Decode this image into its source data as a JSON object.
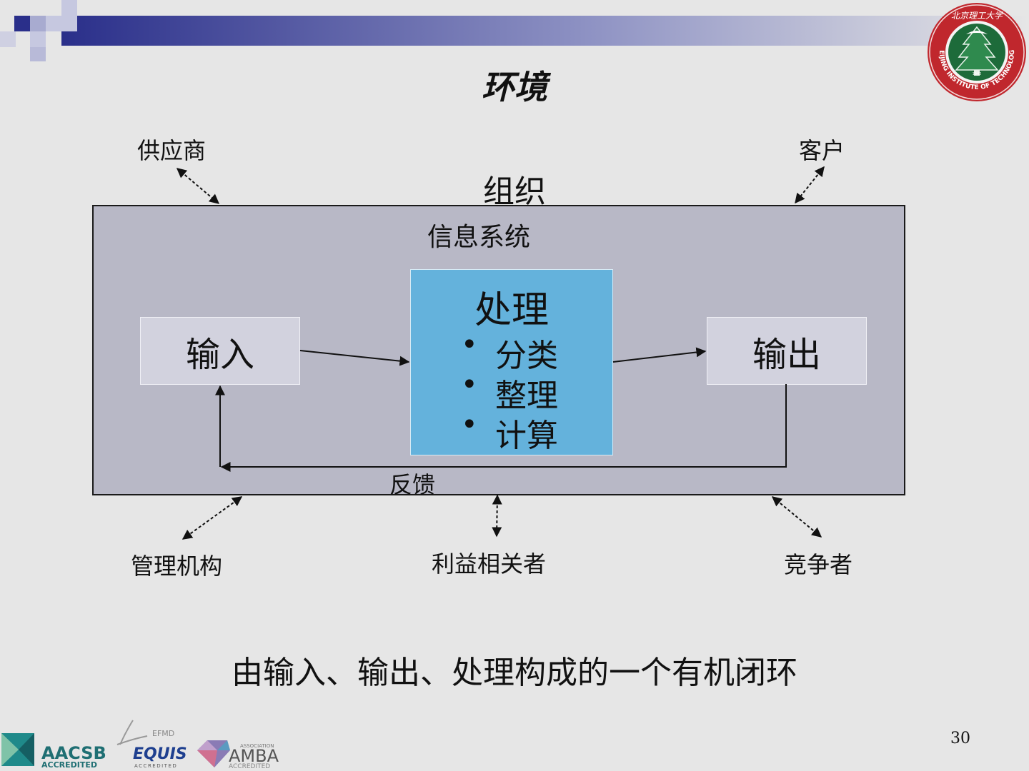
{
  "slide": {
    "title": "环境",
    "page_number": "30",
    "caption": "由输入、输出、处理构成的一个有机闭环"
  },
  "diagram": {
    "organization": "组织",
    "information_system": "信息系统",
    "input": "输入",
    "output": "输出",
    "process": {
      "title": "处理",
      "items": [
        "分类",
        "整理",
        "计算"
      ],
      "bullet": "•"
    },
    "feedback": "反馈",
    "external": {
      "supplier": "供应商",
      "customer": "客户",
      "regulator": "管理机构",
      "stakeholder": "利益相关者",
      "competitor": "竞争者"
    }
  },
  "logos": {
    "university": {
      "top_text": "北京理工大学",
      "ring_text": "BEIJING INSTITUTE OF TECHNOLOGY",
      "year": "1940"
    },
    "aacsb": {
      "name": "AACSB",
      "sub": "ACCREDITED"
    },
    "equis": {
      "top": "EFMD",
      "name": "EQUIS",
      "sub": "ACCREDITED"
    },
    "amba": {
      "top": "ASSOCIATION",
      "name": "AMBA",
      "sub": "ACCREDITED"
    }
  },
  "colors": {
    "header_navy": "#2a2f8a",
    "org_box": "#b8b8c6",
    "process_box": "#64b2dc",
    "io_box": "#d2d2de",
    "seal_red": "#c0272d",
    "seal_green": "#1d6b3a",
    "aacsb_teal": "#1f8a8a",
    "equis_blue": "#1e3f8f"
  }
}
